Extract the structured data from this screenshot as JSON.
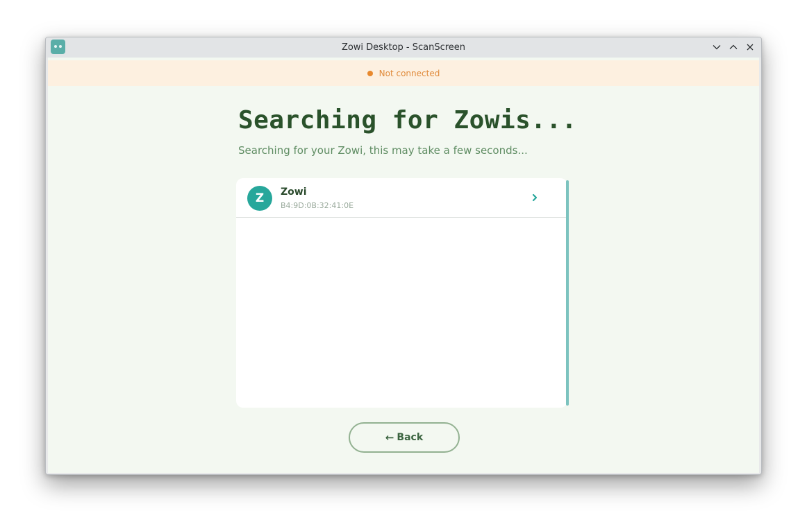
{
  "window": {
    "title": "Zowi Desktop - ScanScreen"
  },
  "status": {
    "text": "Not connected",
    "color": "#e8892e"
  },
  "main": {
    "heading": "Searching for Zowis...",
    "subheading": "Searching for your Zowi, this may take a few seconds..."
  },
  "devices": [
    {
      "initial": "Z",
      "name": "Zowi",
      "address": "B4:9D:0B:32:41:0E"
    }
  ],
  "back_button": {
    "arrow": "←",
    "label": "Back"
  },
  "colors": {
    "accent": "#27a79b",
    "heading": "#2a522b",
    "background": "#f3f8f1",
    "warning_bg": "#fdf0e0"
  }
}
